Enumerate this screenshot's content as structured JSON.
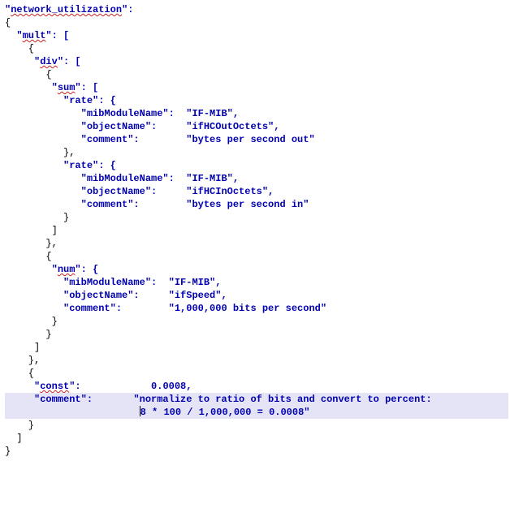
{
  "code": {
    "l01a": "\"",
    "l01b": "network_utilization",
    "l01c": "\":",
    "l02": "{",
    "l03a": "  \"",
    "l03b": "mult",
    "l03c": "\": [",
    "l04": "    {",
    "l05a": "     \"",
    "l05b": "div",
    "l05c": "\": [",
    "l06": "       {",
    "l07a": "        \"",
    "l07b": "sum",
    "l07c": "\": [",
    "l08": "          \"rate\": {",
    "l09": "             \"mibModuleName\":  \"IF-MIB\",",
    "l10": "             \"objectName\":     \"ifHCOutOctets\",",
    "l11": "             \"comment\":        \"bytes per second out\"",
    "l12": "          },",
    "l13": "          \"rate\": {",
    "l14": "             \"mibModuleName\":  \"IF-MIB\",",
    "l15": "             \"objectName\":     \"ifHCInOctets\",",
    "l16": "             \"comment\":        \"bytes per second in\"",
    "l17": "          }",
    "l18": "        ]",
    "l19": "       },",
    "l20": "       {",
    "l21a": "        \"",
    "l21b": "num",
    "l21c": "\": {",
    "l22": "          \"mibModuleName\":  \"IF-MIB\",",
    "l23": "          \"objectName\":     \"ifSpeed\",",
    "l24": "          \"comment\":        \"1,000,000 bits per second\"",
    "l25": "        }",
    "l26": "       }",
    "l27": "     ]",
    "l28": "    },",
    "l29": "    {",
    "l30a": "     \"",
    "l30b": "const",
    "l30c": "\":            0.0008,",
    "l31": "     \"comment\":       \"normalize to ratio of bits and convert to percent:",
    "l32a": "                       ",
    "l32b": "8 * 100 / 1,000,000 = 0.0008\"",
    "l33": "    }",
    "l34": "  ]",
    "l35": "}"
  },
  "chart_data": {
    "type": "table",
    "title": "network_utilization JSON expression",
    "structure": {
      "network_utilization": {
        "mult": [
          {
            "div": [
              {
                "sum": [
                  {
                    "rate": {
                      "mibModuleName": "IF-MIB",
                      "objectName": "ifHCOutOctets",
                      "comment": "bytes per second out"
                    }
                  },
                  {
                    "rate": {
                      "mibModuleName": "IF-MIB",
                      "objectName": "ifHCInOctets",
                      "comment": "bytes per second in"
                    }
                  }
                ]
              },
              {
                "num": {
                  "mibModuleName": "IF-MIB",
                  "objectName": "ifSpeed",
                  "comment": "1,000,000 bits per second"
                }
              }
            ]
          },
          {
            "const": 0.0008,
            "comment": "normalize to ratio of bits and convert to percent: 8 * 100 / 1,000,000 = 0.0008"
          }
        ]
      }
    }
  }
}
